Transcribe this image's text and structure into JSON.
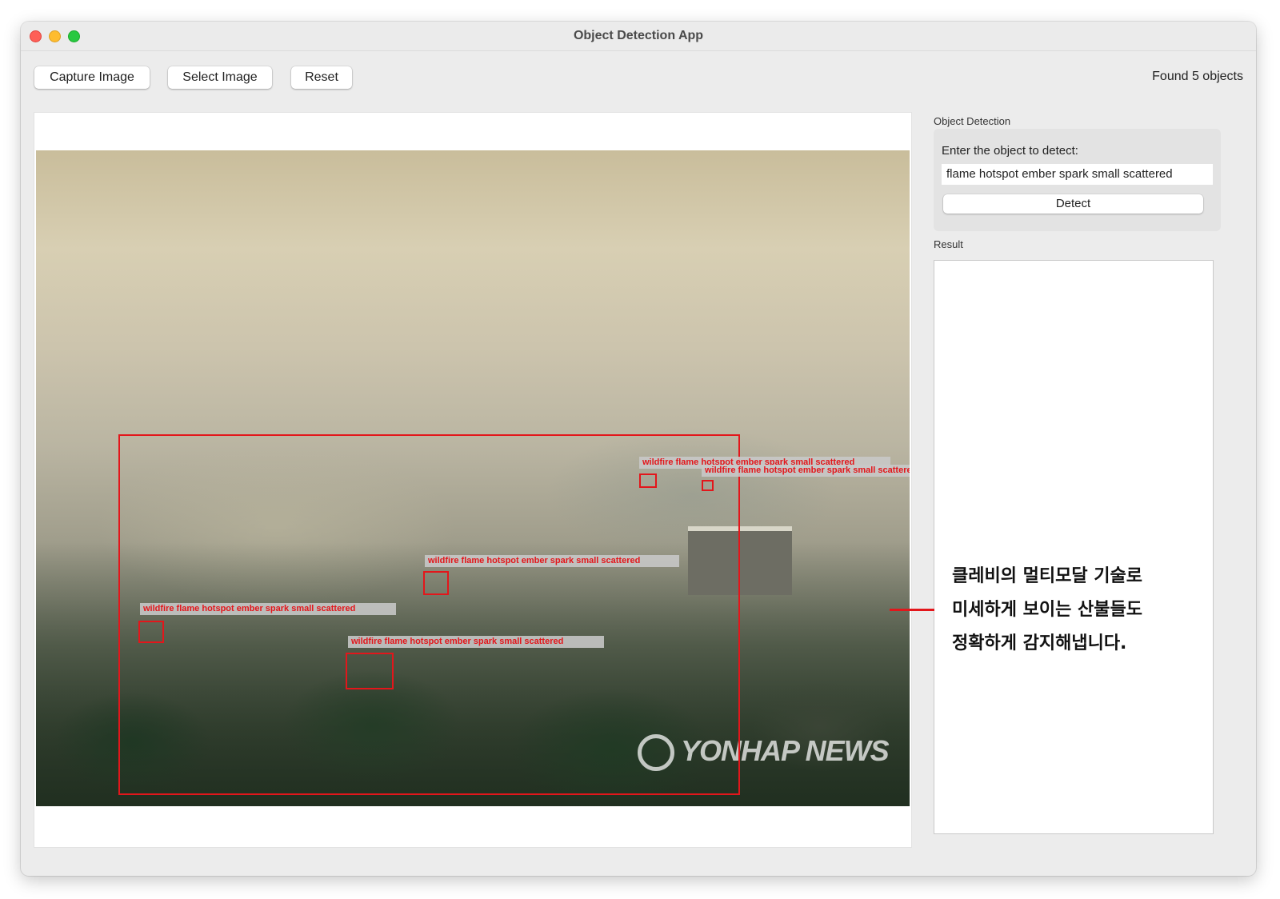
{
  "window": {
    "title": "Object Detection App"
  },
  "toolbar": {
    "capture_label": "Capture Image",
    "select_label": "Select Image",
    "reset_label": "Reset",
    "status": "Found 5 objects"
  },
  "image": {
    "watermark": "YONHAP NEWS",
    "detections": [
      {
        "label": "wildfire flame hotspot ember spark small scattered"
      },
      {
        "label": "wildfire flame hotspot ember spark small scattered"
      },
      {
        "label": "wildfire flame hotspot ember spark small s"
      },
      {
        "label": "wildfire flame hotspot ember spark small scattered"
      },
      {
        "label": "wildfire flame hotspot ember spark small scattered"
      },
      {
        "label": "wildfire flame hotspot ember spark small scattered"
      }
    ]
  },
  "sidebar": {
    "detection_header": "Object Detection",
    "prompt_label": "Enter the object to detect:",
    "object_value": "flame hotspot ember spark small scattered",
    "detect_label": "Detect",
    "result_header": "Result"
  },
  "caption": {
    "lines": [
      "클레비의 멀티모달 기술로",
      "미세하게 보이는 산불들도",
      "정확하게 감지해냅니다."
    ]
  },
  "colors": {
    "detection": "#e3161b",
    "window_bg": "#ececec"
  }
}
